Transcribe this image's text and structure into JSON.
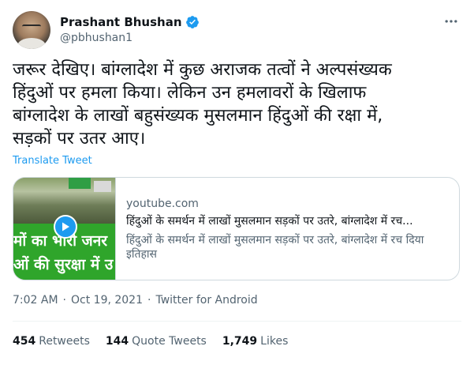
{
  "user": {
    "display_name": "Prashant Bhushan",
    "handle": "@pbhushan1",
    "verified_icon": "verified-badge-icon"
  },
  "tweet": {
    "lines": [
      "जरूर देखिए। बांग्लादेश में कुछ अराजक तत्वों ने अल्पसंख्यक",
      "हिंदुओं पर हमला किया। लेकिन उन हमलावरों के खिलाफ",
      "बांग्लादेश के लाखों बहुसंख्यक मुसलमान हिंदुओं की रक्षा में,",
      "सड़कों पर उतर आए।"
    ],
    "translate_label": "Translate Tweet"
  },
  "card": {
    "domain": "youtube.com",
    "title": "हिंदुओं के समर्थन में लाखों मुसलमान सड़कों पर उतरे, बांग्लादेश में रच...",
    "description": "हिंदुओं के समर्थन में लाखों मुसलमान सड़कों पर उतरे, बांग्लादेश में रच दिया इतिहास",
    "thumbnail_line1": "मों का भारी जनर",
    "thumbnail_line2": "ओं की सुरक्षा में उ",
    "play_icon": "play-icon"
  },
  "meta": {
    "time": "7:02 AM",
    "separator1": "·",
    "date": "Oct 19, 2021",
    "separator2": "·",
    "source": "Twitter for Android"
  },
  "stats": {
    "retweets_count": "454",
    "retweets_label": "Retweets",
    "quotes_count": "144",
    "quotes_label": "Quote Tweets",
    "likes_count": "1,749",
    "likes_label": "Likes"
  },
  "colors": {
    "accent": "#1d9bf0",
    "text": "#0f1419",
    "secondary": "#536471",
    "border": "#cfd9de"
  }
}
